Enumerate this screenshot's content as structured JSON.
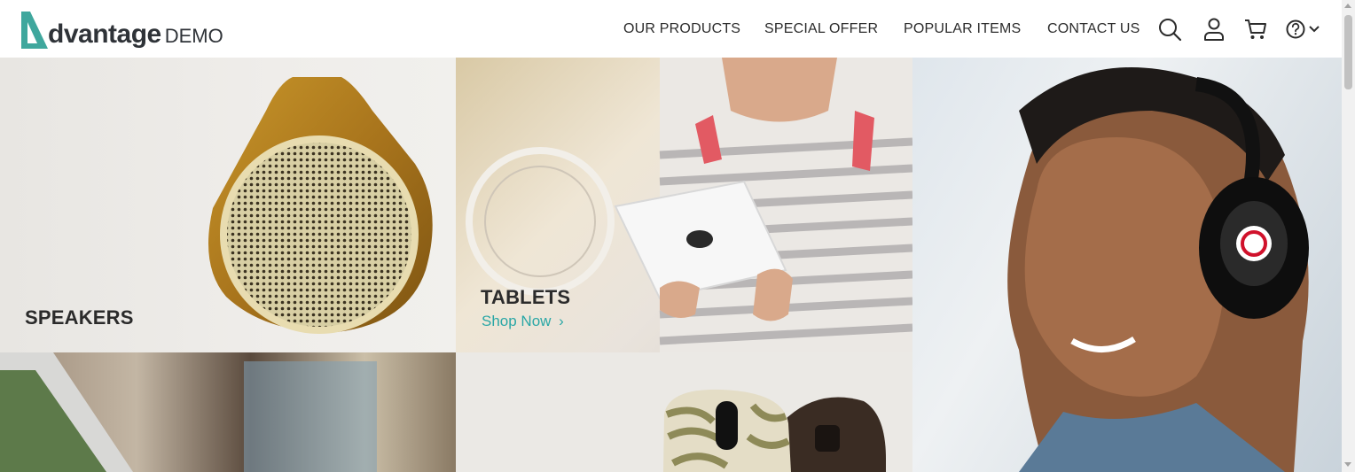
{
  "brand": {
    "word": "dvantage",
    "suffix": "DEMO",
    "accent": "#3fa79d"
  },
  "nav": [
    {
      "label": "OUR PRODUCTS"
    },
    {
      "label": "SPECIAL OFFER"
    },
    {
      "label": "POPULAR ITEMS"
    },
    {
      "label": "CONTACT US"
    }
  ],
  "header_icons": [
    "search-icon",
    "user-icon",
    "cart-icon",
    "help-icon",
    "chevron-down-icon"
  ],
  "tiles": {
    "speakers": {
      "title": "SPEAKERS"
    },
    "tablets": {
      "title": "TABLETS",
      "cta": "Shop Now"
    },
    "headphones": {},
    "laptops": {},
    "mice": {}
  },
  "colors": {
    "link": "#2aa7a6",
    "text": "#2c2c2c"
  }
}
